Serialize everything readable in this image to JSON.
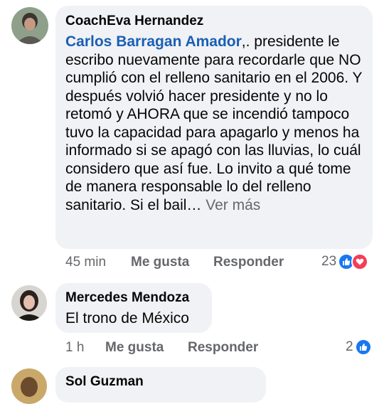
{
  "comments": [
    {
      "author": "CoachEva Hernandez",
      "mention": "Carlos Barragan Amador",
      "text": ",. presidente le escribo nuevamente para recordarle que NO cumplió con  el relleno sanitario en el 2006. Y después volvió hacer presidente y no lo retomó y AHORA que se incendió tampoco tuvo la capacidad para apagarlo y menos ha informado si se apagó con las lluvias, lo cuál considero que así fue. Lo invito a qué tome de manera responsable lo del relleno sanitario. Si el bail…",
      "see_more": "Ver más",
      "time": "45 min",
      "like_label": "Me gusta",
      "reply_label": "Responder",
      "reaction_count": "23",
      "reactions": [
        "like-icon",
        "love-icon"
      ]
    },
    {
      "author": "Mercedes Mendoza",
      "text": "El trono de México",
      "time": "1 h",
      "like_label": "Me gusta",
      "reply_label": "Responder",
      "reaction_count": "2",
      "reactions": [
        "like-icon"
      ]
    },
    {
      "author": "Sol Guzman"
    }
  ],
  "colors": {
    "bubble": "#f0f2f5",
    "mention": "#1a5fb4",
    "meta": "#65676b",
    "like": "#1877f2",
    "love": "#f33e58"
  }
}
